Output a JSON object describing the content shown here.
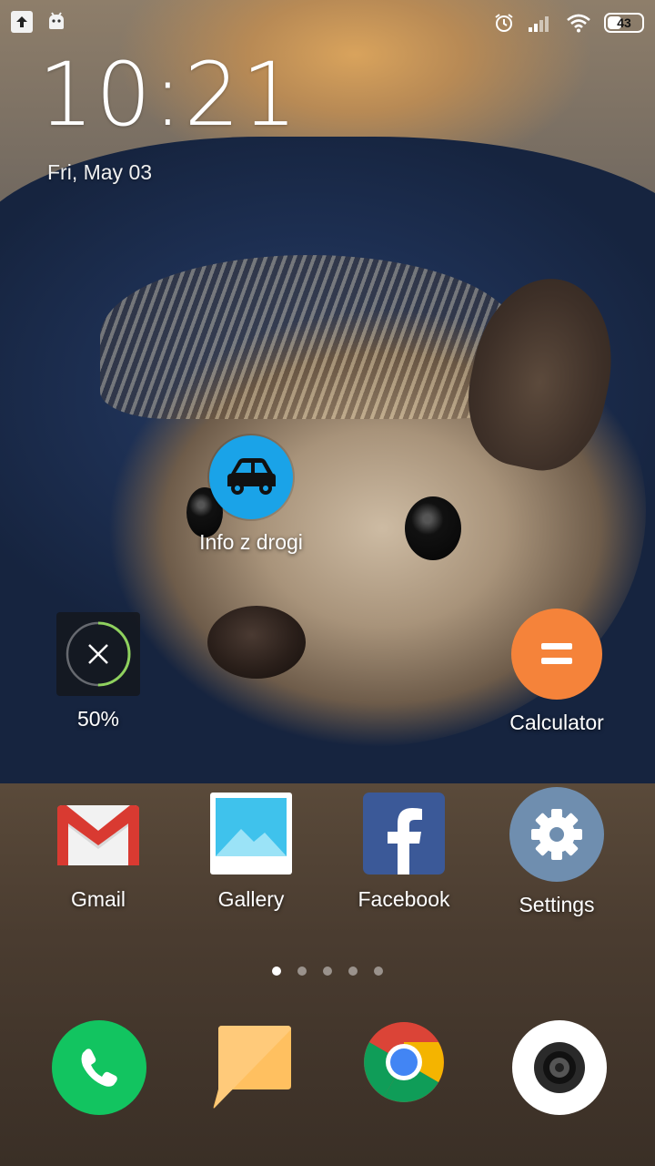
{
  "status_bar": {
    "left_icons": [
      "upload-icon",
      "android-icon"
    ],
    "right_icons": [
      "alarm-icon",
      "signal-icon",
      "wifi-icon"
    ],
    "battery_level": "43"
  },
  "clock_widget": {
    "time": "10:21",
    "date": "Fri, May 03"
  },
  "home_apps": {
    "info_z_drogi": {
      "label": "Info z drogi",
      "icon": "car-icon",
      "color": "#1aa3e8"
    },
    "cleaner": {
      "label": "50%",
      "icon": "close-icon",
      "progress": 0.5
    },
    "calculator": {
      "label": "Calculator",
      "icon": "equals-icon",
      "color": "#f5833a"
    },
    "gmail": {
      "label": "Gmail",
      "icon": "gmail-icon"
    },
    "gallery": {
      "label": "Gallery",
      "icon": "gallery-icon"
    },
    "facebook": {
      "label": "Facebook",
      "icon": "facebook-icon",
      "color": "#3b5998"
    },
    "settings": {
      "label": "Settings",
      "icon": "gear-icon",
      "color": "#6f8eaf"
    }
  },
  "page_indicator": {
    "pages": 5,
    "active": 1
  },
  "dock": [
    {
      "name": "phone",
      "icon": "phone-icon",
      "color": "#12c460"
    },
    {
      "name": "messaging",
      "icon": "message-icon",
      "color": "#ffc060"
    },
    {
      "name": "chrome",
      "icon": "chrome-icon"
    },
    {
      "name": "camera",
      "icon": "camera-icon"
    }
  ]
}
